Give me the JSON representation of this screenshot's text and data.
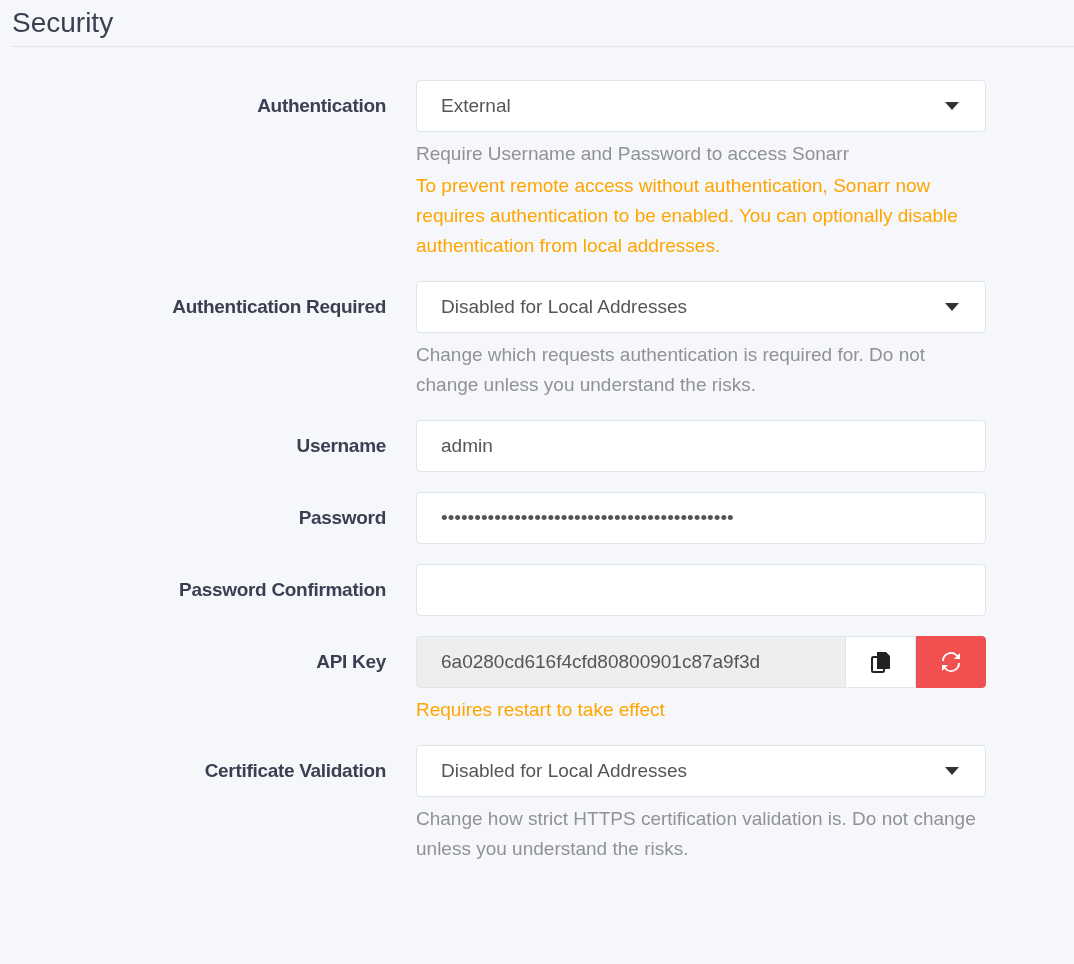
{
  "section_title": "Security",
  "fields": [
    {
      "kind": "select",
      "label": "Authentication",
      "value": "External",
      "help": [
        {
          "kind": "info",
          "text": "Require Username and Password to access Sonarr"
        },
        {
          "kind": "warning",
          "text": "To prevent remote access without authentication, Sonarr now requires authentication to be enabled. You can optionally disable authentication from local addresses."
        }
      ]
    },
    {
      "kind": "select",
      "label": "Authentication Required",
      "value": "Disabled for Local Addresses",
      "help": [
        {
          "kind": "info",
          "text": "Change which requests authentication is required for. Do not change unless you understand the risks."
        }
      ]
    },
    {
      "kind": "text",
      "label": "Username",
      "value": "admin"
    },
    {
      "kind": "text",
      "label": "Password",
      "value": "••••••••••••••••••••••••••••••••••••••••••••"
    },
    {
      "kind": "text",
      "label": "Password Confirmation"
    },
    {
      "kind": "apikey",
      "label": "API Key",
      "value": "6a0280cd616f4cfd80800901c87a9f3d",
      "help": [
        {
          "kind": "warning",
          "text": "Requires restart to take effect"
        }
      ]
    },
    {
      "kind": "select",
      "label": "Certificate Validation",
      "value": "Disabled for Local Addresses",
      "help": [
        {
          "kind": "info",
          "text": "Change how strict HTTPS certification validation is. Do not change unless you understand the risks."
        }
      ]
    }
  ]
}
